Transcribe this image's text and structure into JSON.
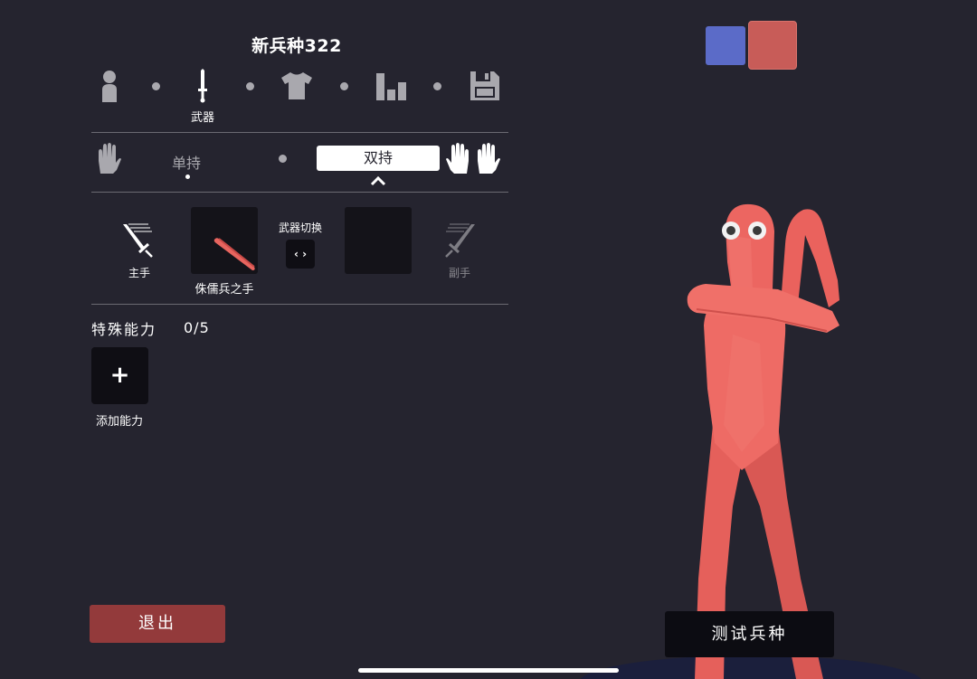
{
  "title": "新兵种322",
  "nav": {
    "items": [
      {
        "id": "body",
        "icon": "person-icon"
      },
      {
        "id": "weapon",
        "icon": "sword-icon",
        "label": "武器",
        "active": true
      },
      {
        "id": "clothing",
        "icon": "shirt-icon"
      },
      {
        "id": "stats",
        "icon": "bar-chart-icon"
      },
      {
        "id": "save",
        "icon": "floppy-disk-icon"
      }
    ]
  },
  "grip": {
    "single_label": "单持",
    "dual_label": "双持",
    "selected": "dual"
  },
  "weapons": {
    "main_hand_label": "主手",
    "main_weapon_name": "侏儒兵之手",
    "switch_label": "武器切换",
    "switch_icon": "‹ ›",
    "off_hand_label": "副手"
  },
  "abilities": {
    "title": "特殊能力",
    "count": "0/5",
    "add_icon": "+",
    "add_label": "添加能力"
  },
  "buttons": {
    "exit": "退出",
    "test": "测试兵种"
  },
  "colors": {
    "background": "#25242f",
    "team_blue": "#5b6bc8",
    "team_red": "#c85c58",
    "exit_red": "#933a3b",
    "unit_skin": "#e8655f"
  }
}
